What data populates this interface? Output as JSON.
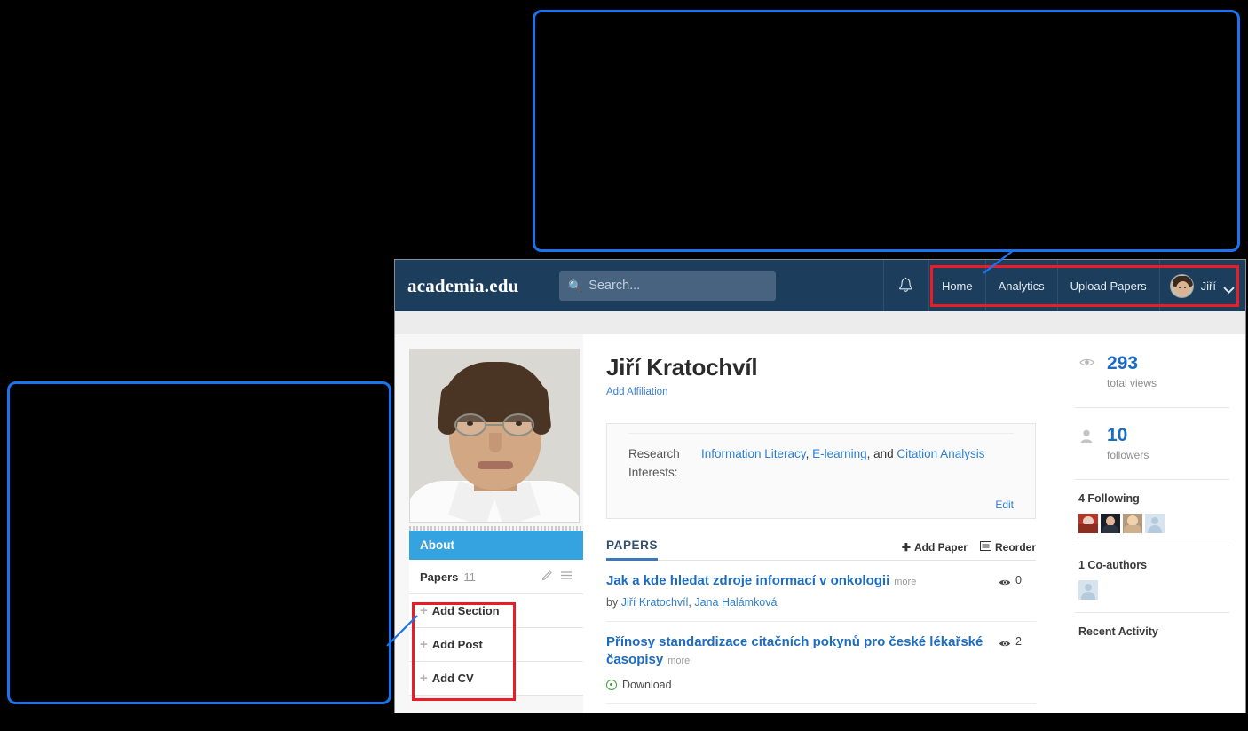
{
  "header": {
    "brand": "academia.edu",
    "search": {
      "placeholder": "Search...",
      "value": "",
      "icon": "search-icon"
    },
    "bell_icon": "bell-icon",
    "nav": [
      {
        "label": "Home"
      },
      {
        "label": "Analytics"
      },
      {
        "label": "Upload Papers"
      }
    ],
    "user": {
      "name": "Jiří",
      "avatar": "user-avatar",
      "chevron": "chevron-down-icon"
    }
  },
  "profile": {
    "name": "Jiří Kratochvíl",
    "add_affiliation": "Add Affiliation",
    "photo_alt": "profile-photo"
  },
  "research_interests": {
    "label": "Research Interests:",
    "label_line1": "Research",
    "label_line2": "Interests:",
    "values": [
      "Information Literacy",
      "E-learning",
      "Citation Analysis"
    ],
    "separator": ", ",
    "conjunction": " and ",
    "edit_label": "Edit"
  },
  "sidebar": {
    "about_label": "About",
    "papers": {
      "label": "Papers",
      "count": "11",
      "edit_icon": "pencil-icon",
      "reorder_icon": "hamburger-icon"
    },
    "add_items": [
      {
        "label": "Add Section",
        "icon": "plus-icon"
      },
      {
        "label": "Add Post",
        "icon": "plus-icon"
      },
      {
        "label": "Add CV",
        "icon": "plus-icon"
      }
    ]
  },
  "papers_section": {
    "title": "PAPERS",
    "add_paper": "Add Paper",
    "add_paper_icon": "plus-icon",
    "reorder": "Reorder",
    "reorder_icon": "reorder-icon",
    "more_label": "more",
    "by_label": "by",
    "download_label": "Download",
    "items": [
      {
        "title": "Jak a kde hledat zdroje informací v onkologii",
        "authors": [
          "Jiří Kratochvíl",
          "Jana Halámková"
        ],
        "views": "0",
        "has_download": false
      },
      {
        "title": "Přínosy standardizace citačních pokynů pro české lékařské časopisy",
        "authors": [],
        "views": "2",
        "has_download": true
      }
    ]
  },
  "stats": {
    "total_views": {
      "value": "293",
      "label": "total views",
      "icon": "eye-icon"
    },
    "followers": {
      "value": "10",
      "label": "followers",
      "icon": "person-icon"
    },
    "following_title": "4 Following",
    "coauthors_title": "1 Co-authors",
    "recent_activity_title": "Recent Activity"
  },
  "annotations": {
    "highlight_color": "#ed1c24",
    "callout_border_color": "#1a73f0",
    "callouts": [
      {
        "name": "nav-callout",
        "target": "top-navigation-links"
      },
      {
        "name": "add-items-callout",
        "target": "sidebar-add-items"
      }
    ]
  }
}
